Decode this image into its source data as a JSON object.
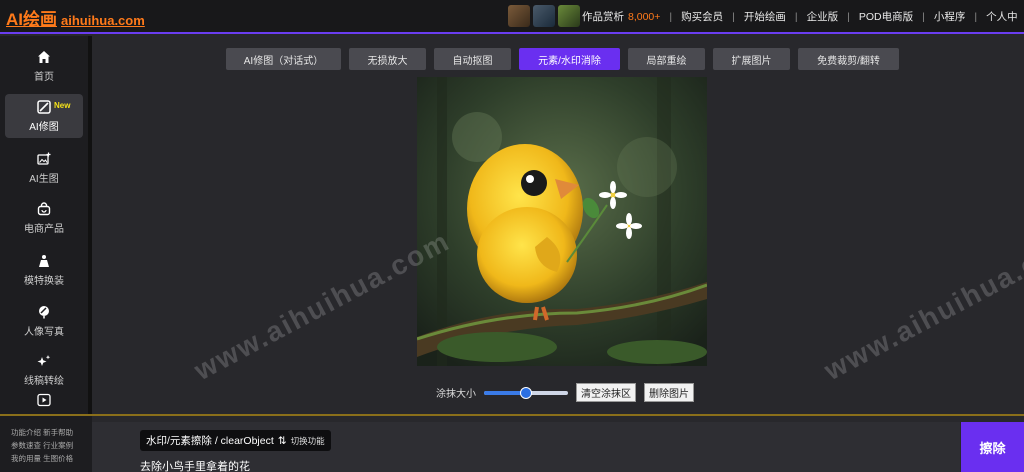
{
  "header": {
    "logo_text": "AI绘画",
    "logo_domain": "aihuihua.com",
    "showcase_label": "作品赏析",
    "showcase_count": "8,000+",
    "nav": [
      "购买会员",
      "开始绘画",
      "企业版",
      "POD电商版",
      "小程序",
      "个人中"
    ]
  },
  "sidebar": {
    "items": [
      {
        "label": "首页",
        "icon": "home-icon"
      },
      {
        "label": "AI修图",
        "icon": "magic-edit-icon",
        "badge": "New"
      },
      {
        "label": "AI生图",
        "icon": "image-plus-icon"
      },
      {
        "label": "电商产品",
        "icon": "bag-icon"
      },
      {
        "label": "模特换装",
        "icon": "dress-icon"
      },
      {
        "label": "人像写真",
        "icon": "portrait-icon"
      },
      {
        "label": "线稿转绘",
        "icon": "sparkle-icon"
      },
      {
        "label": "",
        "icon": "video-icon"
      }
    ]
  },
  "toolbar": {
    "tabs": [
      "AI修图（对话式）",
      "无损放大",
      "自动抠图",
      "元素/水印消除",
      "局部重绘",
      "扩展图片",
      "免费裁剪/翻转"
    ],
    "active_index": 3
  },
  "canvas": {
    "watermark": "www.aihuihua.com"
  },
  "controls": {
    "brush_label": "涂抹大小",
    "brush_size": 0.5,
    "clear_btn": "清空涂抹区",
    "delete_btn": "删除图片"
  },
  "bottom": {
    "links": [
      "功能介绍",
      "新手帮助",
      "参数速查",
      "行业案例",
      "我的用量",
      "生图价格"
    ],
    "mode_tag": "水印/元素擦除 / clearObject",
    "mode_switch": "切换功能",
    "prompt": "去除小鸟手里拿着的花",
    "submit": "擦除"
  },
  "colors": {
    "accent": "#6a2ff0",
    "brand": "#ff7a1a",
    "badge": "#f5e21a"
  }
}
